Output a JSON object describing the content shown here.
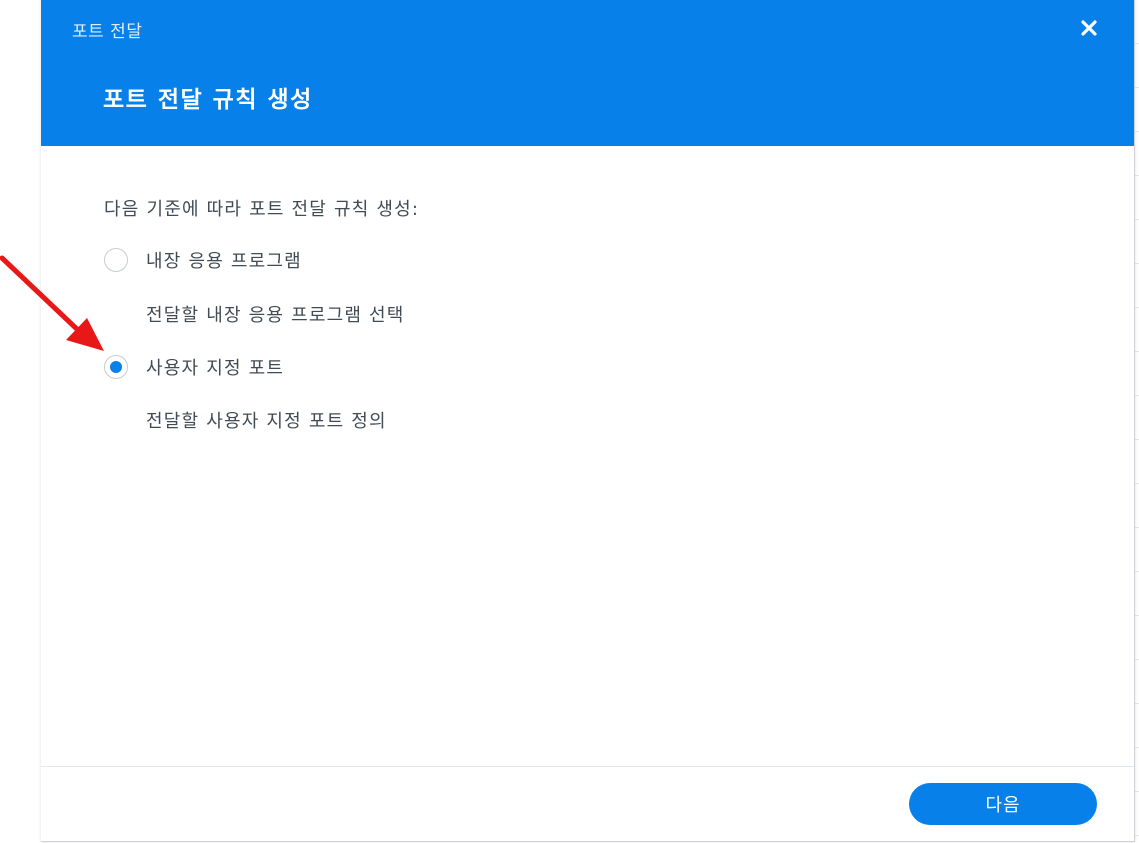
{
  "dialog": {
    "window_title": "포트 전달",
    "step_title": "포트 전달 규칙 생성",
    "close_icon": "close-icon"
  },
  "form": {
    "instruction": "다음 기준에 따라 포트 전달 규칙 생성:",
    "options": [
      {
        "label": "내장 응용 프로그램",
        "description": "전달할 내장 응용 프로그램 선택",
        "selected": false
      },
      {
        "label": "사용자 지정 포트",
        "description": "전달할 사용자 지정 포트 정의",
        "selected": true
      }
    ]
  },
  "footer": {
    "next_label": "다음"
  },
  "colors": {
    "accent": "#0780ea",
    "annotation_arrow": "#e81818"
  }
}
